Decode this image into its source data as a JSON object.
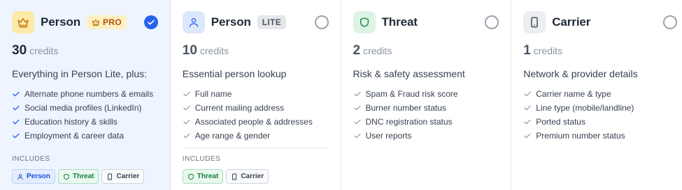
{
  "plans": [
    {
      "name": "Person",
      "tier": "PRO",
      "credits": "30",
      "credits_unit": "credits",
      "description": "Everything in Person Lite, plus:",
      "features": [
        "Alternate phone numbers & emails",
        "Social media profiles (LinkedIn)",
        "Education history & skills",
        "Employment & career data"
      ],
      "includes_label": "INCLUDES",
      "includes": [
        "Person",
        "Threat",
        "Carrier"
      ],
      "selected": true
    },
    {
      "name": "Person",
      "tier": "LITE",
      "credits": "10",
      "credits_unit": "credits",
      "description": "Essential person lookup",
      "features": [
        "Full name",
        "Current mailing address",
        "Associated people & addresses",
        "Age range & gender"
      ],
      "includes_label": "INCLUDES",
      "includes": [
        "Threat",
        "Carrier"
      ],
      "selected": false
    },
    {
      "name": "Threat",
      "credits": "2",
      "credits_unit": "credits",
      "description": "Risk & safety assessment",
      "features": [
        "Spam & Fraud risk score",
        "Burner number status",
        "DNC registration status",
        "User reports"
      ],
      "selected": false
    },
    {
      "name": "Carrier",
      "credits": "1",
      "credits_unit": "credits",
      "description": "Network & provider details",
      "features": [
        "Carrier name & type",
        "Line type (mobile/landline)",
        "Ported status",
        "Premium number status"
      ],
      "selected": false
    }
  ],
  "icons": {
    "person_pro": "crown-icon",
    "person_lite": "user-icon",
    "threat": "shield-icon",
    "carrier": "phone-icon",
    "feature": "check-icon"
  },
  "colors": {
    "accent_blue": "#2563eb",
    "selected_bg": "#eef5ff",
    "pro_badge_bg": "#fdf0c2",
    "pro_badge_fg": "#b45309",
    "threat_green": "#15803d"
  }
}
